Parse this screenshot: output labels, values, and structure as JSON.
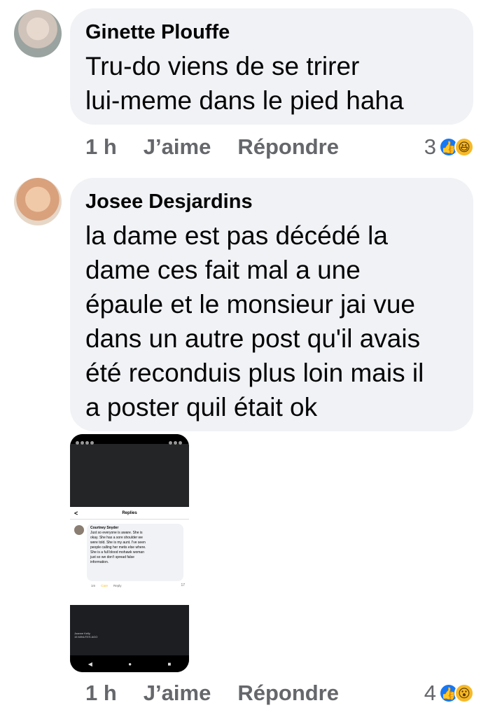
{
  "comments": [
    {
      "author": "Ginette Plouffe",
      "text": "Tru-do viens de se trirer\nlui-meme dans le pied haha",
      "time": "1 h",
      "like_label": "J’aime",
      "reply_label": "Répondre",
      "reaction_count": "3",
      "reactions": [
        "like-icon",
        "haha-icon"
      ]
    },
    {
      "author": "Josee Desjardins",
      "text": "la dame est pas décédé la\ndame ces fait mal a une\népaule et le monsieur jai vue\ndans un autre post qu'il avais\nété reconduis plus loin mais il\na poster quil était ok",
      "time": "1 h",
      "like_label": "J’aime",
      "reply_label": "Répondre",
      "reaction_count": "4",
      "reactions": [
        "like-icon",
        "wow-icon"
      ]
    }
  ],
  "attachment": {
    "header": "Replies",
    "back": "<",
    "author": "Courtney Snyder",
    "text": "Just so everyone is aware. She is\nokay. She has a sore shoulder we\nwere told. She is my aunt. I've seen\npeople calling her metis else where.\nShe is a full blood mohawk woman\njust so we don't spread false\ninformation.",
    "time": "1m",
    "care": "Care",
    "reply": "Reply",
    "react_count": "17",
    "footer_name": "Joanne Kelly\n15 MINUTES AGO",
    "nav": [
      "◀",
      "●",
      "■"
    ]
  },
  "colors": {
    "bubble": "#f0f2f5",
    "meta": "#65676b",
    "like": "#1877f2",
    "emoji": "#f7b928"
  }
}
